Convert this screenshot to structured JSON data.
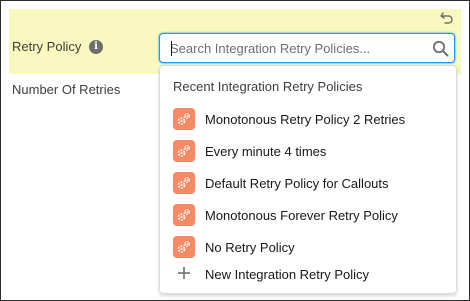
{
  "field": {
    "label": "Retry Policy",
    "info_icon_glyph": "i",
    "undo_icon": "undo-icon"
  },
  "retries_field": {
    "label": "Number Of Retries"
  },
  "search": {
    "value": "",
    "placeholder": "Search Integration Retry Policies...",
    "icon": "search-icon"
  },
  "dropdown": {
    "header": "Recent Integration Retry Policies",
    "items": [
      {
        "label": "Monotonous Retry Policy 2 Retries",
        "icon": "gears-icon"
      },
      {
        "label": "Every minute 4 times",
        "icon": "gears-icon"
      },
      {
        "label": "Default Retry Policy for Callouts",
        "icon": "gears-icon"
      },
      {
        "label": "Monotonous Forever Retry Policy",
        "icon": "gears-icon"
      },
      {
        "label": "No Retry Policy",
        "icon": "gears-icon"
      }
    ],
    "new_action": {
      "label": "New Integration Retry Policy",
      "icon": "plus-icon"
    }
  },
  "colors": {
    "highlight": "#f9f9bf",
    "focus_border": "#1b96ff",
    "record_icon_bg": "#f88962",
    "text": "#181818"
  }
}
